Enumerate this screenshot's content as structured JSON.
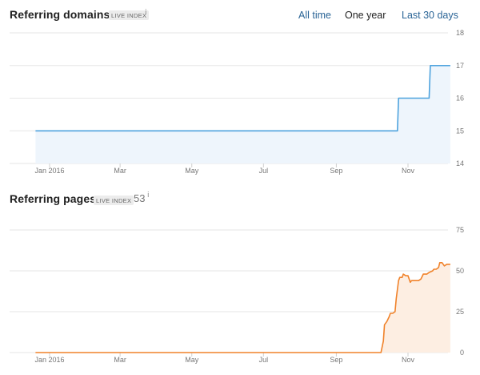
{
  "header": {
    "title": "Referring domains",
    "badge": "LIVE INDEX",
    "info_icon": "info-icon",
    "range_buttons": [
      {
        "label": "All time",
        "active": false
      },
      {
        "label": "One year",
        "active": true
      },
      {
        "label": "Last 30 days",
        "active": false
      }
    ]
  },
  "section2": {
    "title": "Referring pages",
    "badge": "LIVE INDEX",
    "count": "53",
    "info_icon": "info-icon"
  },
  "colors": {
    "domains_line": "#4ea3de",
    "domains_fill": "#eef5fc",
    "pages_line": "#f0822a",
    "pages_fill": "#fdeee2",
    "grid": "#e6e6e6",
    "link": "#2a6496"
  },
  "chart_data": [
    {
      "type": "area",
      "title": "Referring domains",
      "x_tick_labels": [
        "Jan 2016",
        "Mar",
        "May",
        "Jul",
        "Sep",
        "Nov"
      ],
      "y_ticks": [
        14,
        15,
        16,
        17,
        18
      ],
      "ylim": [
        14,
        18
      ],
      "y_axis_position": "right",
      "grid": true,
      "series": [
        {
          "x": [
            "2015-12-20",
            "2016-10-23",
            "2016-10-24",
            "2016-11-19",
            "2016-11-20",
            "2016-12-07"
          ],
          "values": [
            15,
            15,
            16,
            16,
            17,
            17
          ]
        }
      ]
    },
    {
      "type": "area",
      "title": "Referring pages",
      "x_tick_labels": [
        "Jan 2016",
        "Mar",
        "May",
        "Jul",
        "Sep",
        "Nov"
      ],
      "y_ticks": [
        0,
        25,
        50,
        75
      ],
      "ylim": [
        0,
        75
      ],
      "y_axis_position": "right",
      "grid": true,
      "series": [
        {
          "x": [
            "2015-12-20",
            "2016-10-09",
            "2016-10-11",
            "2016-10-12",
            "2016-10-14",
            "2016-10-16",
            "2016-10-17",
            "2016-10-19",
            "2016-10-21",
            "2016-10-22",
            "2016-10-24",
            "2016-10-25",
            "2016-10-27",
            "2016-10-28",
            "2016-10-30",
            "2016-11-01",
            "2016-11-03",
            "2016-11-04",
            "2016-11-08",
            "2016-11-10",
            "2016-11-12",
            "2016-11-14",
            "2016-11-17",
            "2016-11-19",
            "2016-11-22",
            "2016-11-23",
            "2016-11-25",
            "2016-11-27",
            "2016-11-28",
            "2016-11-30",
            "2016-12-02",
            "2016-12-04",
            "2016-12-07"
          ],
          "values": [
            0,
            0,
            7,
            17,
            19,
            22,
            24,
            24,
            25,
            33,
            44,
            46,
            46,
            48,
            47,
            47,
            43,
            44,
            44,
            44,
            45,
            48,
            48,
            49,
            50,
            51,
            51,
            52,
            55,
            55,
            53,
            54,
            54
          ]
        }
      ]
    }
  ]
}
